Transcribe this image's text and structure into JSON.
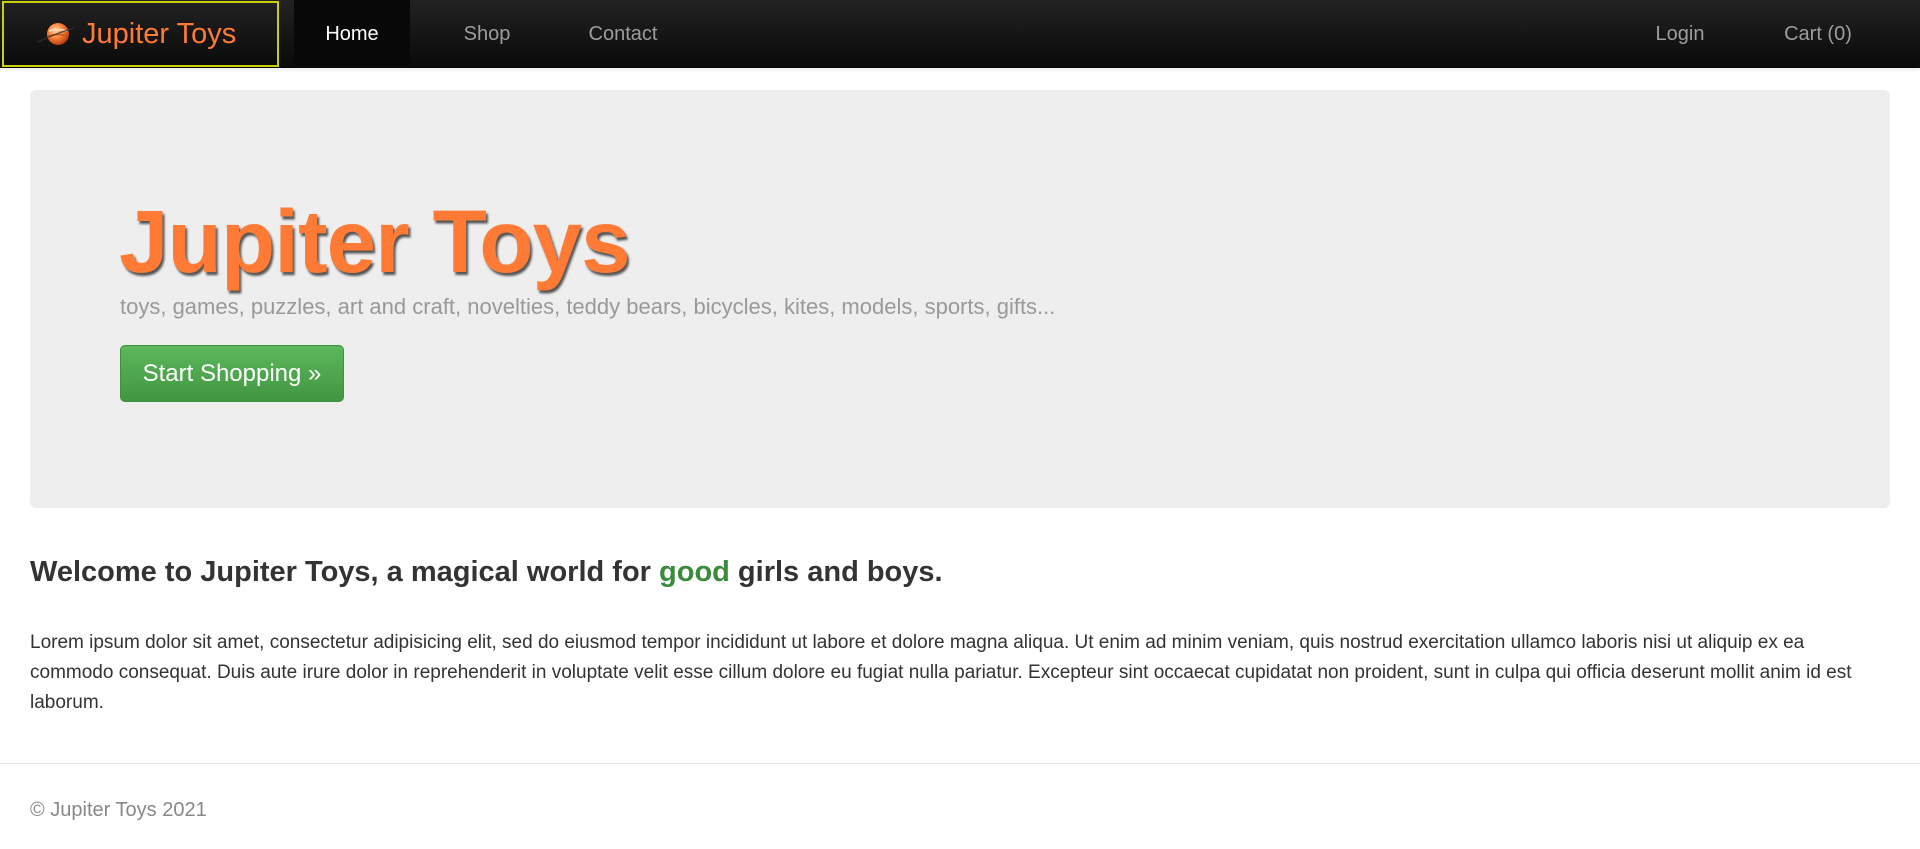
{
  "brand": {
    "name": "Jupiter Toys",
    "icon": "planet-icon",
    "color": "#ff7b35"
  },
  "nav": {
    "home": "Home",
    "shop": "Shop",
    "contact": "Contact",
    "login": "Login",
    "cart": "Cart (0)",
    "active": "Home"
  },
  "hero": {
    "title": "Jupiter Toys",
    "tagline": "toys, games, puzzles, art and craft, novelties, teddy bears, bicycles, kites, models, sports, gifts...",
    "button_label": "Start Shopping »"
  },
  "welcome": {
    "prefix": "Welcome to Jupiter Toys, a magical world for ",
    "highlight": "good",
    "suffix": " girls and boys.",
    "highlight_color": "#3c8a3c"
  },
  "body_text": "Lorem ipsum dolor sit amet, consectetur adipisicing elit, sed do eiusmod tempor incididunt ut labore et dolore magna aliqua. Ut enim ad minim veniam, quis nostrud exercitation ullamco laboris nisi ut aliquip ex ea commodo consequat. Duis aute irure dolor in reprehenderit in voluptate velit esse cillum dolore eu fugiat nulla pariatur. Excepteur sint occaecat cupidatat non proident, sunt in culpa qui officia deserunt mollit anim id est laborum.",
  "footer": {
    "copyright": "© Jupiter Toys 2021"
  }
}
